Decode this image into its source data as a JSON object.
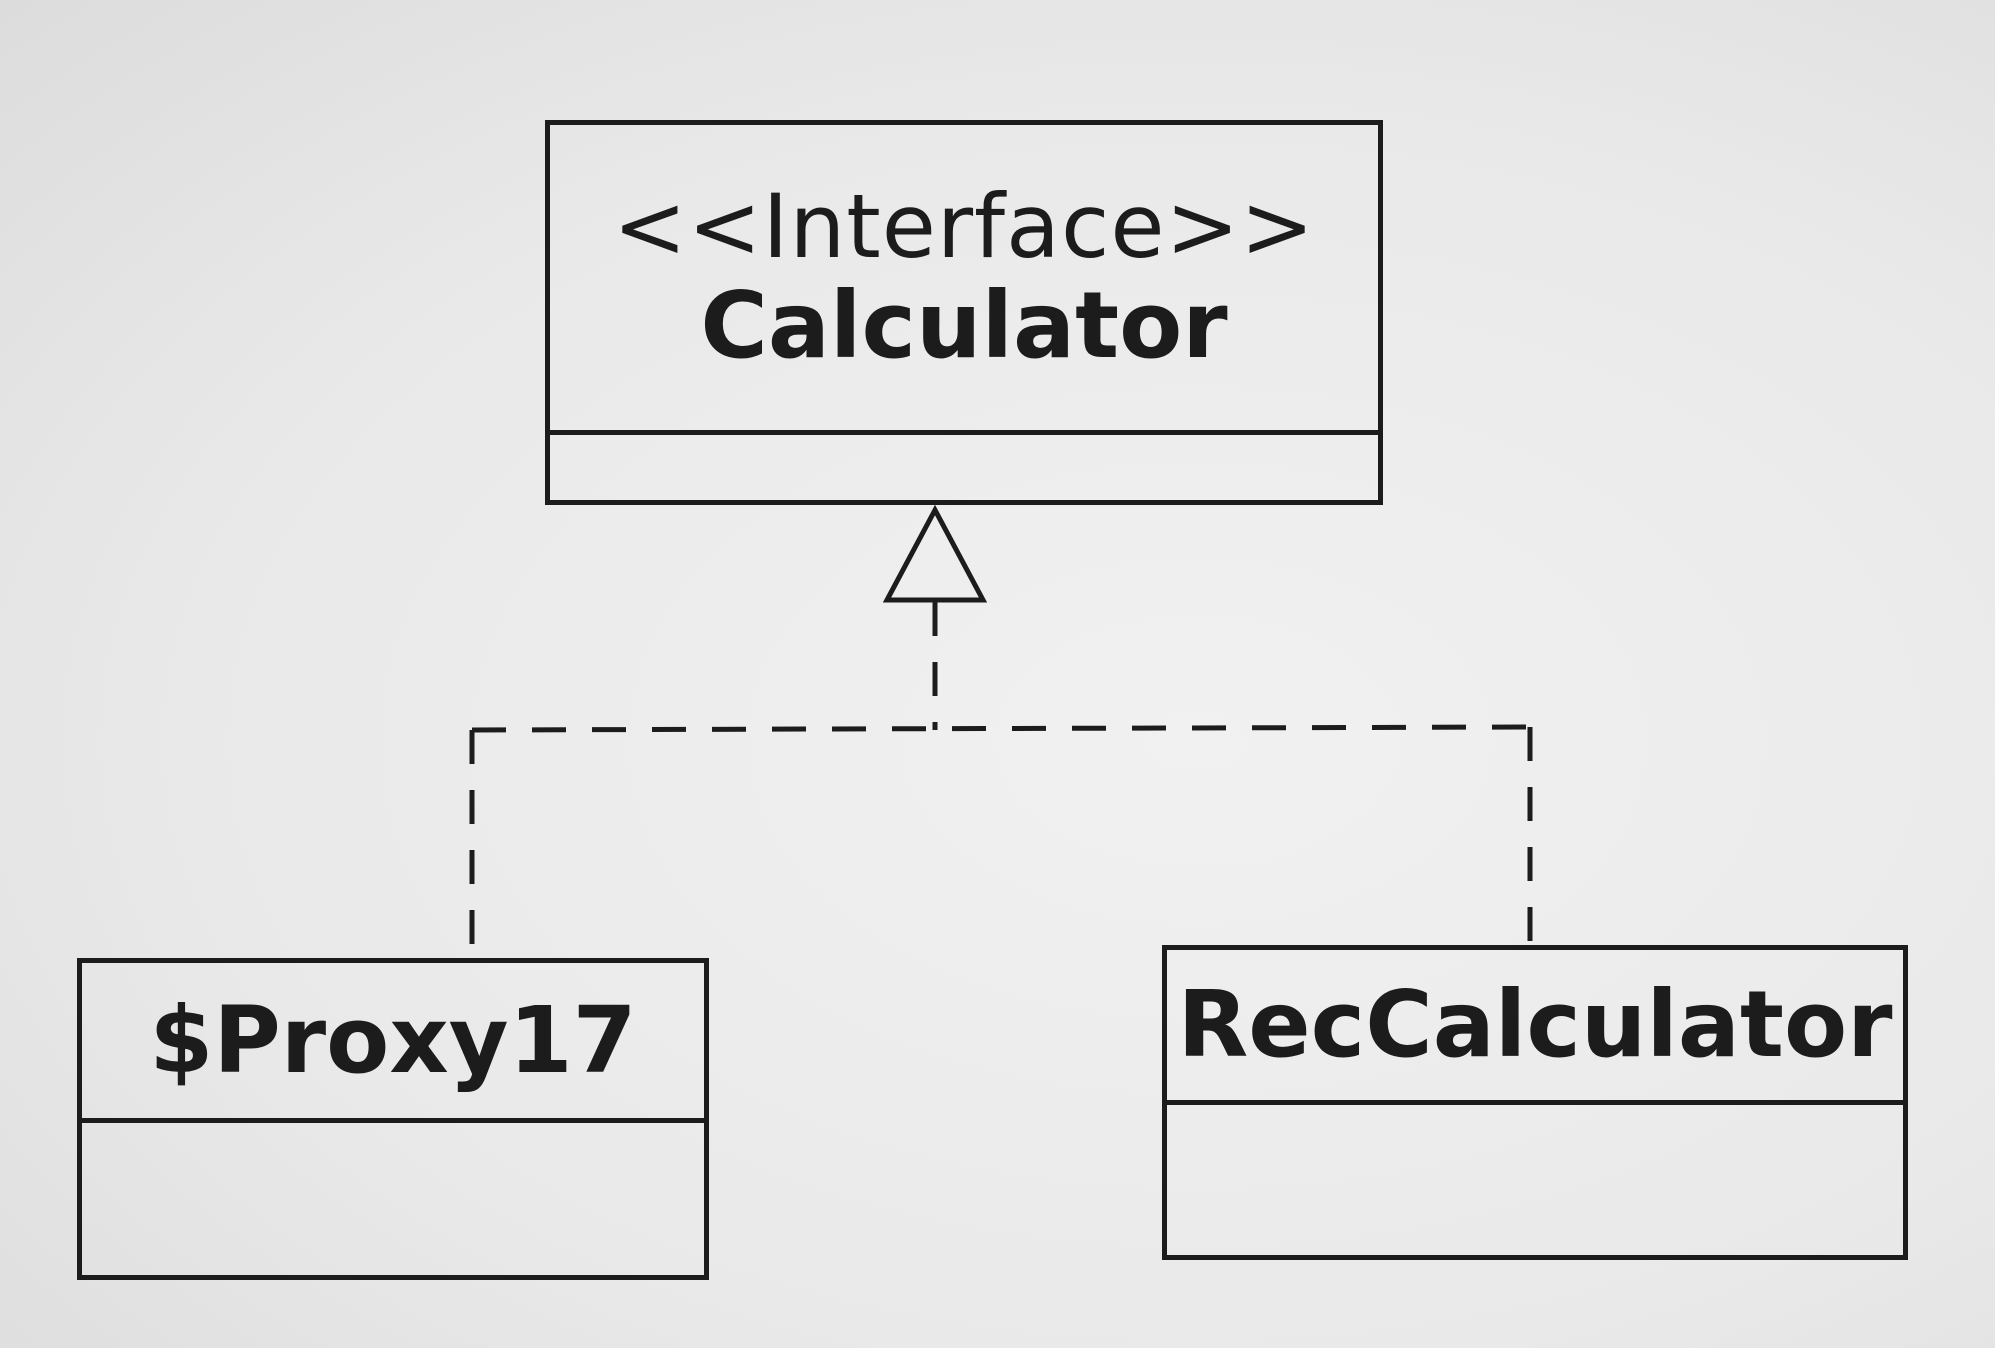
{
  "diagram": {
    "interface_box": {
      "stereotype": "<<Interface>>",
      "name": "Calculator"
    },
    "implementations": [
      {
        "name": "$Proxy17"
      },
      {
        "name": "RecCalculator"
      }
    ],
    "relationship": "realization"
  }
}
